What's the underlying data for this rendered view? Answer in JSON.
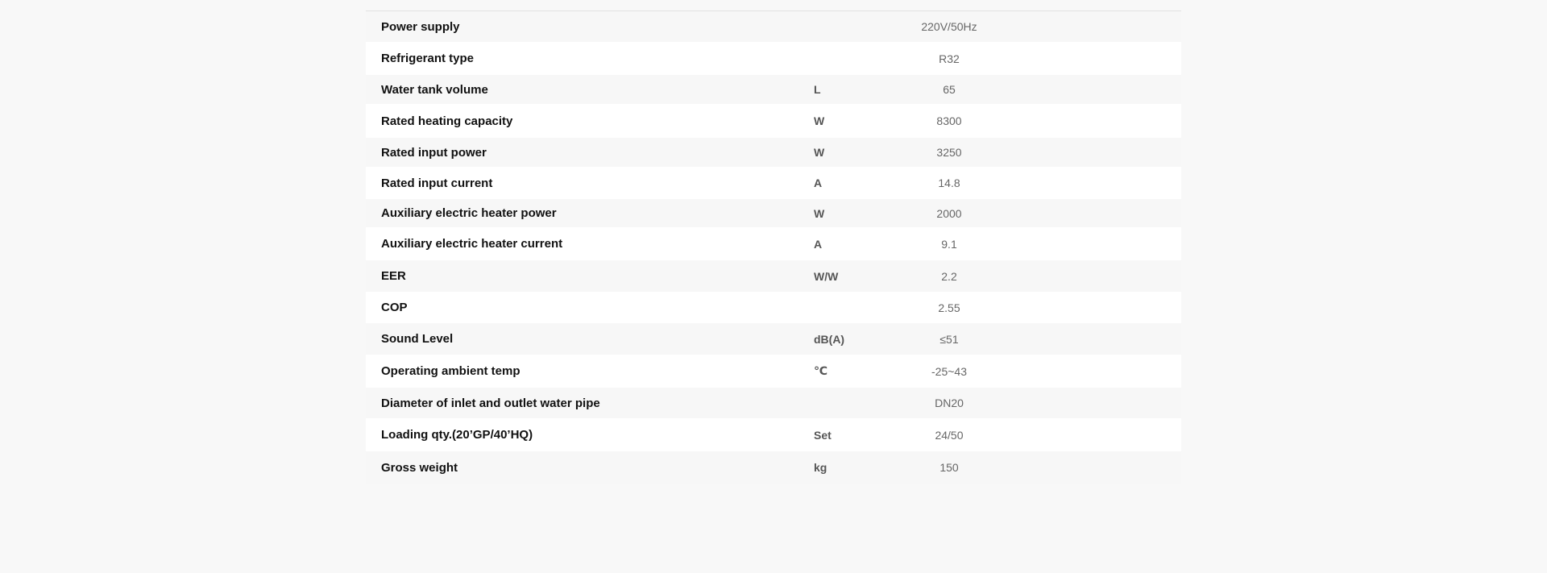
{
  "specs": {
    "rows": [
      {
        "name": "Power supply",
        "unit": "",
        "value": "220V/50Hz"
      },
      {
        "name": "Refrigerant type",
        "unit": "",
        "value": "R32"
      },
      {
        "name": "Water tank volume",
        "unit": "L",
        "value": "65"
      },
      {
        "name": "Rated heating capacity",
        "unit": "W",
        "value": "8300"
      },
      {
        "name": "Rated input power",
        "unit": "W",
        "value": "3250"
      },
      {
        "name": "Rated input current",
        "unit": "A",
        "value": "14.8"
      },
      {
        "name": "Auxiliary electric heater power",
        "unit": "W",
        "value": "2000"
      },
      {
        "name": "Auxiliary electric heater current",
        "unit": "A",
        "value": "9.1"
      },
      {
        "name": "EER",
        "unit": "W/W",
        "value": "2.2"
      },
      {
        "name": "COP",
        "unit": "",
        "value": "2.55"
      },
      {
        "name": "Sound Level",
        "unit": "dB(A)",
        "value": "≤51"
      },
      {
        "name": "Operating ambient temp",
        "unit": "℃",
        "value": "-25~43"
      },
      {
        "name": "Diameter of inlet and outlet water pipe",
        "unit": "",
        "value": "DN20"
      },
      {
        "name": "Loading qty.(20’GP/40’HQ)",
        "unit": "Set",
        "value": "24/50"
      },
      {
        "name": "Gross weight",
        "unit": "kg",
        "value": "150"
      }
    ]
  }
}
